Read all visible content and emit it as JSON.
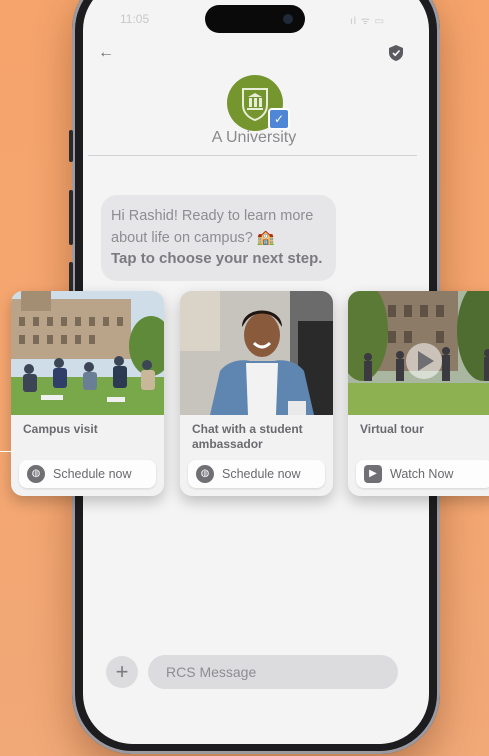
{
  "status_bar": {
    "time": "11:05",
    "indicators": "ıl ᯤ ▭"
  },
  "header": {
    "back_icon": "←",
    "org_name": "A University"
  },
  "message": {
    "text": "Hi Rashid! Ready to learn more about life on campus? 🏫",
    "cta": "Tap to choose your next step."
  },
  "cards": [
    {
      "title": "Campus visit",
      "action_label": "Schedule now",
      "action_icon": "globe-icon"
    },
    {
      "title": "Chat with a student ambassador",
      "action_label": "Schedule now",
      "action_icon": "globe-icon"
    },
    {
      "title": "Virtual tour",
      "action_label": "Watch Now",
      "action_icon": "play-icon"
    }
  ],
  "composer": {
    "plus": "+",
    "placeholder": "RCS Message"
  },
  "colors": {
    "background": "#f6a46c",
    "logo_green": "#75952f",
    "verified_blue": "#4f86d6"
  }
}
